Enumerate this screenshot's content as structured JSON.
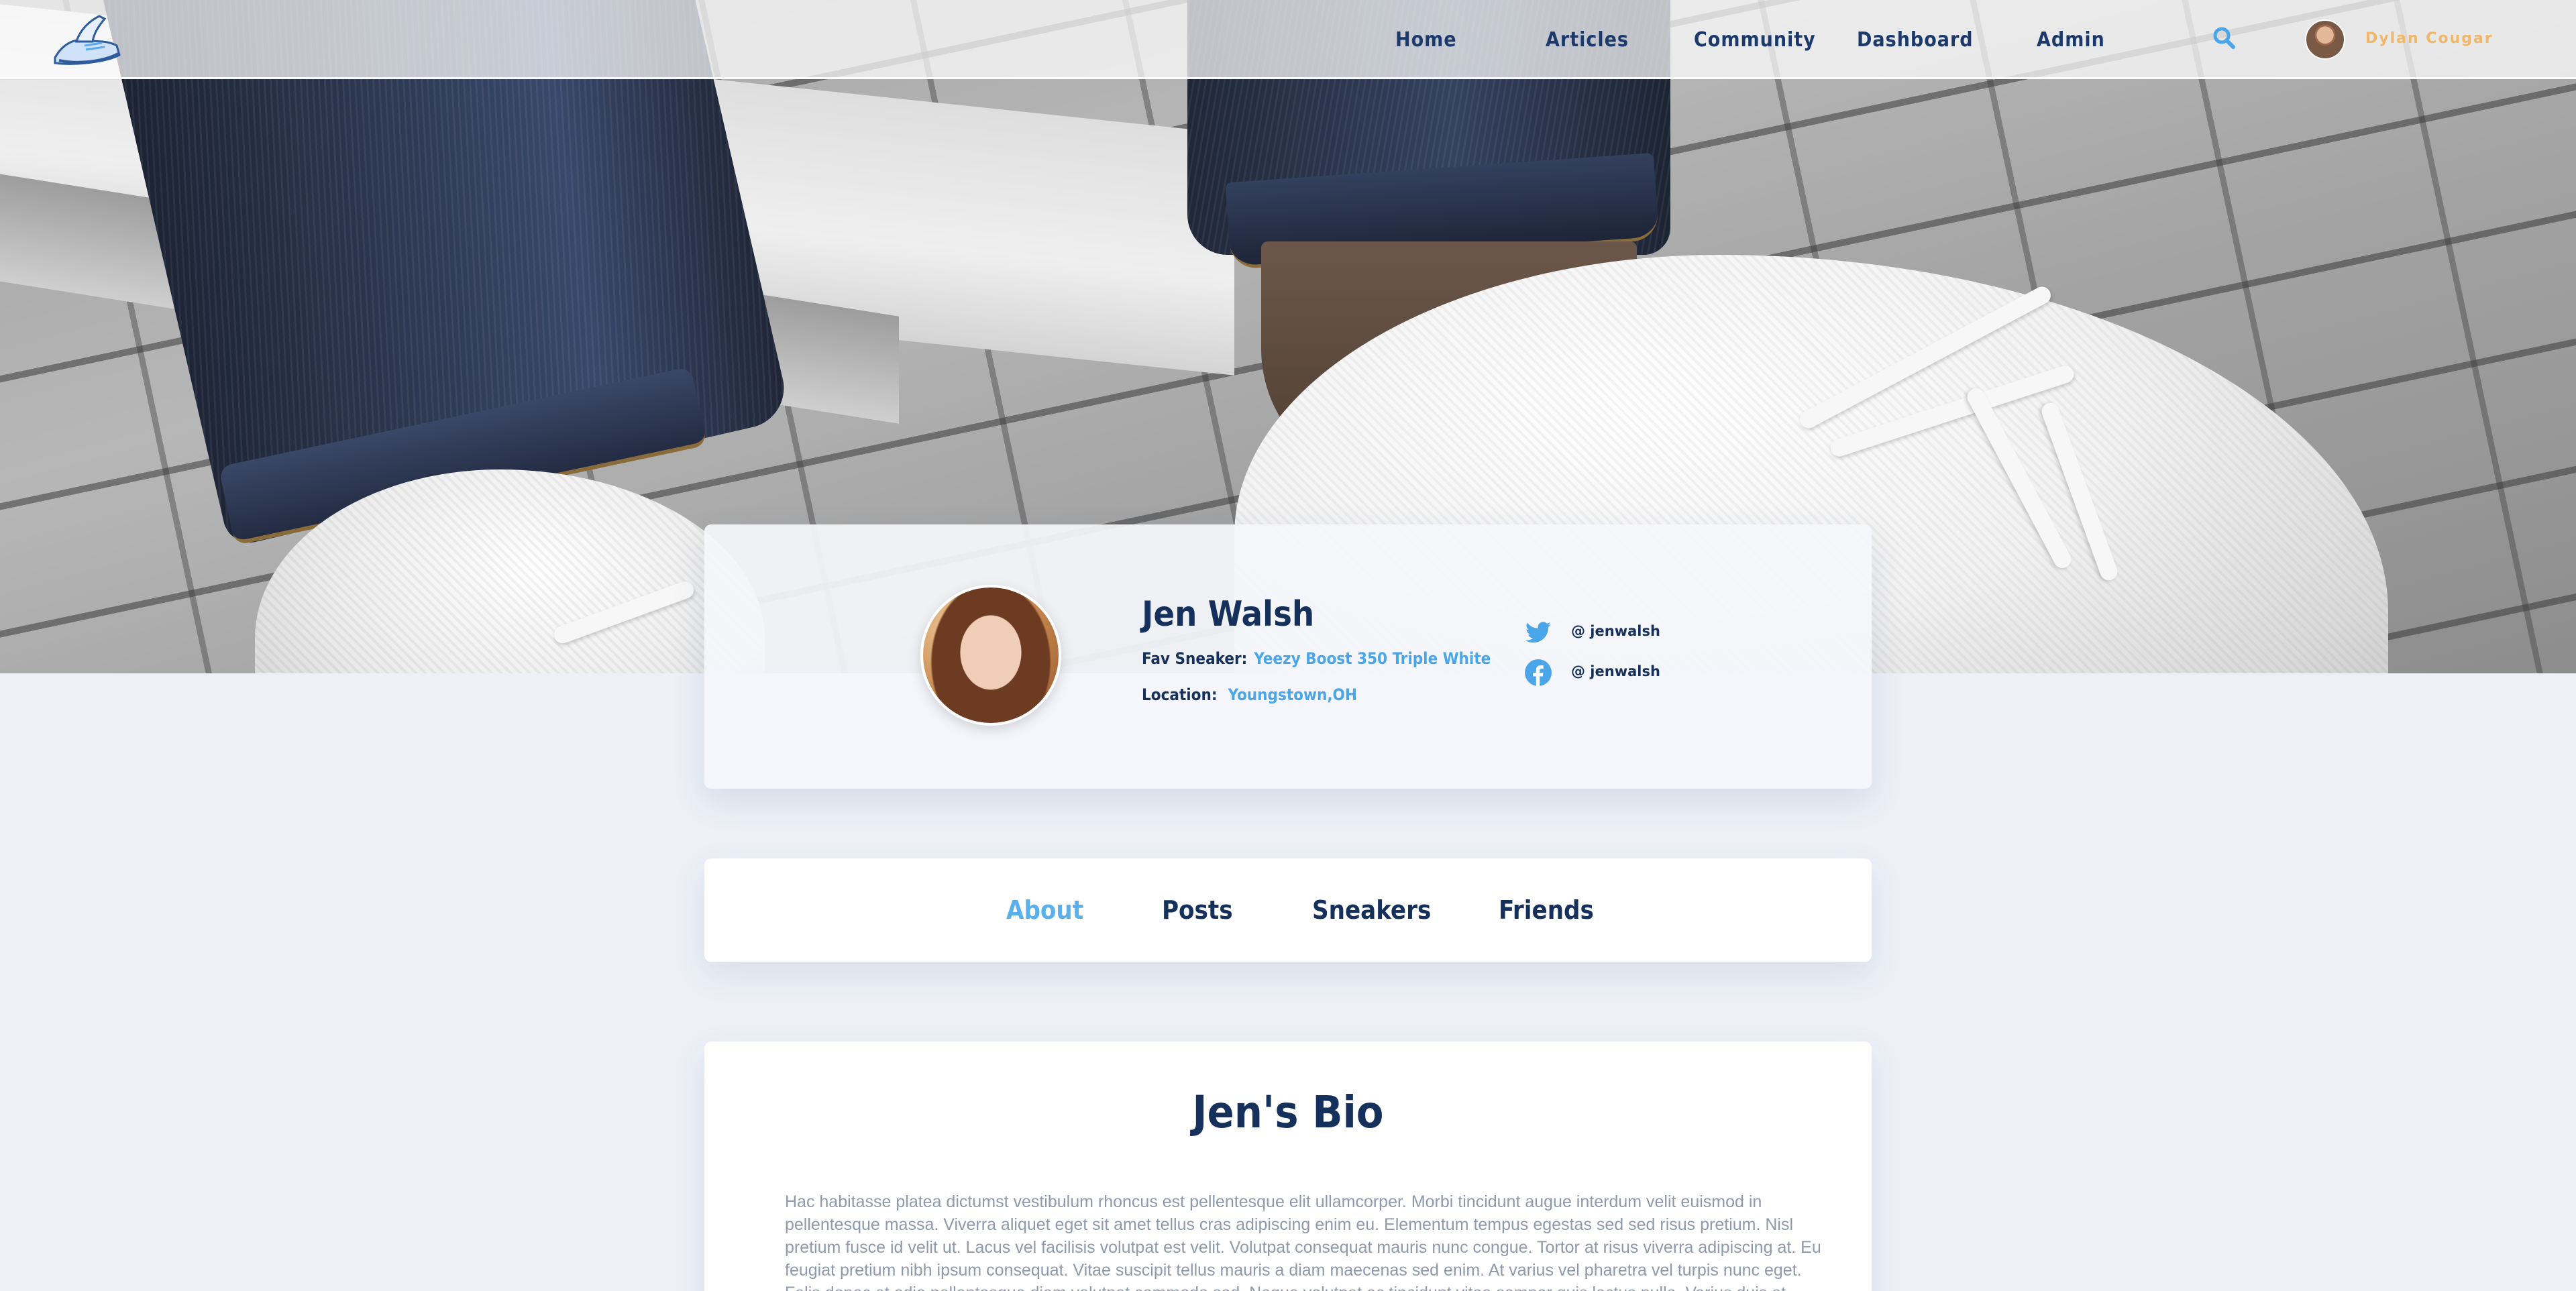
{
  "nav": {
    "links": [
      "Home",
      "Articles",
      "Community",
      "Dashboard",
      "Admin"
    ],
    "user_name": "Dylan Cougar",
    "icons": {
      "logo": "sneaker-logo-icon",
      "search": "search-icon"
    }
  },
  "profile": {
    "name": "Jen Walsh",
    "fav_sneaker_label": "Fav Sneaker:",
    "fav_sneaker_value": "Yeezy Boost 350 Triple White",
    "location_label": "Location:",
    "location_value": "Youngstown,OH",
    "socials": [
      {
        "network": "twitter",
        "handle": "@ jenwalsh"
      },
      {
        "network": "facebook",
        "handle": "@ jenwalsh"
      }
    ]
  },
  "tabs": {
    "items": [
      "About",
      "Posts",
      "Sneakers",
      "Friends"
    ],
    "active": "About"
  },
  "bio": {
    "title": "Jen's Bio",
    "text": "Hac habitasse platea dictumst vestibulum rhoncus est pellentesque elit ullamcorper. Morbi tincidunt augue interdum velit euismod in pellentesque massa. Viverra aliquet eget sit amet tellus cras adipiscing enim eu. Elementum tempus egestas sed sed risus pretium. Nisl pretium fusce id velit ut. Lacus vel facilisis volutpat est velit. Volutpat consequat mauris nunc congue. Tortor at risus viverra adipiscing at. Eu feugiat pretium nibh ipsum consequat. Vitae suscipit tellus mauris a diam maecenas sed enim. At varius vel pharetra vel turpis nunc eget. Felis donec et odio pellentesque diam volutpat commodo sed. Neque volutpat ac tincidunt vitae semper quis lectus nulla. Varius duis at consectetur"
  },
  "colors": {
    "navy": "#16305c",
    "accent_blue": "#4aa6e8",
    "user_name_gold": "#f0b76a",
    "page_bg": "#edf0f7",
    "bio_text": "#8e99ab"
  }
}
